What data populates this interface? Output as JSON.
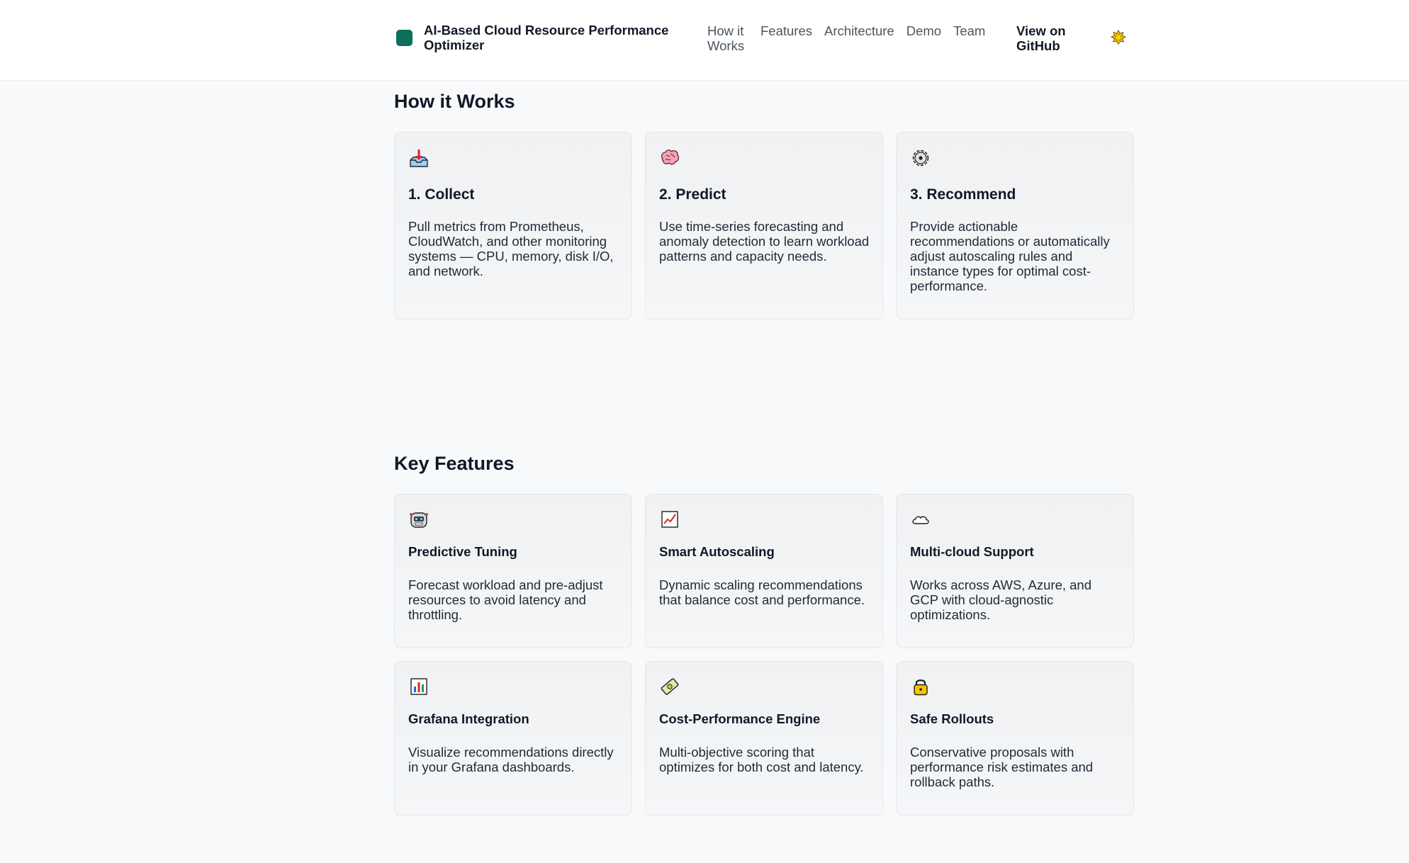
{
  "header": {
    "brand_title": "AI-Based Cloud Resource Performance Optimizer",
    "brand_color": "#0f6e5c",
    "nav": [
      {
        "label": "How it Works"
      },
      {
        "label": "Features"
      },
      {
        "label": "Architecture"
      },
      {
        "label": "Demo"
      },
      {
        "label": "Team"
      }
    ],
    "github_label": "View on GitHub",
    "theme_toggle_icon": "sun-icon"
  },
  "how_it_works": {
    "title": "How it Works",
    "steps": [
      {
        "icon": "inbox-tray-icon",
        "title": "1. Collect",
        "text": "Pull metrics from Prometheus, CloudWatch, and other monitoring systems — CPU, memory, disk I/O, and network."
      },
      {
        "icon": "brain-icon",
        "title": "2. Predict",
        "text": "Use time-series forecasting and anomaly detection to learn workload patterns and capacity needs."
      },
      {
        "icon": "gear-icon",
        "title": "3. Recommend",
        "text": "Provide actionable recommendations or automatically adjust autoscaling rules and instance types for optimal cost-performance."
      }
    ]
  },
  "features": {
    "title": "Key Features",
    "items": [
      {
        "icon": "robot-icon",
        "title": "Predictive Tuning",
        "text": "Forecast workload and pre-adjust resources to avoid latency and throttling."
      },
      {
        "icon": "chart-increasing-icon",
        "title": "Smart Autoscaling",
        "text": "Dynamic scaling recommendations that balance cost and performance."
      },
      {
        "icon": "cloud-icon",
        "title": "Multi-cloud Support",
        "text": "Works across AWS, Azure, and GCP with cloud-agnostic optimizations."
      },
      {
        "icon": "bar-chart-icon",
        "title": "Grafana Integration",
        "text": "Visualize recommendations directly in your Grafana dashboards."
      },
      {
        "icon": "money-icon",
        "title": "Cost-Performance Engine",
        "text": "Multi-objective scoring that optimizes for both cost and latency."
      },
      {
        "icon": "lock-icon",
        "title": "Safe Rollouts",
        "text": "Conservative proposals with performance risk estimates and rollback paths."
      }
    ]
  }
}
